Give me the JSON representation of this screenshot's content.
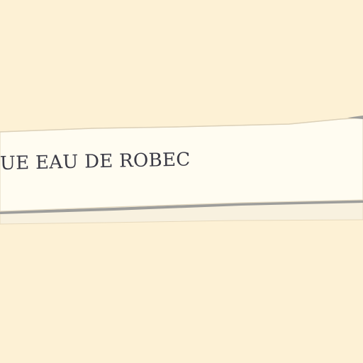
{
  "sign": {
    "text": "UE EAU DE ROBEC"
  },
  "colors": {
    "background": "#fdf1d5",
    "banner_fill": "#fffcf1",
    "banner_shadow": "#9d9d9b",
    "banner_under": "#f8f1df",
    "text": "#3a3a45"
  }
}
